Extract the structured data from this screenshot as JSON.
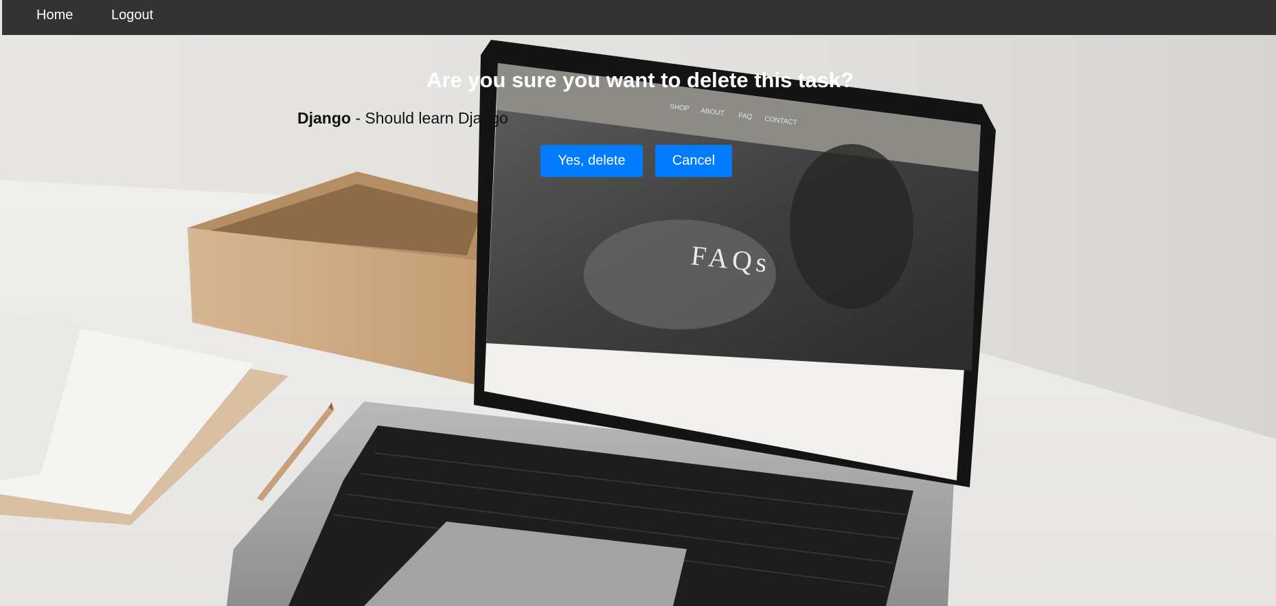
{
  "nav": {
    "home_label": "Home",
    "logout_label": "Logout"
  },
  "confirm": {
    "title": "Are you sure you want to delete this task?",
    "task_title": "Django",
    "separator": " - ",
    "task_description": "Should learn Django",
    "yes_label": "Yes, delete",
    "cancel_label": "Cancel"
  },
  "background_photo": {
    "screen_text": "FAQs"
  },
  "colors": {
    "navbar": "#333333",
    "button": "#007bff",
    "title": "#ffffff"
  }
}
